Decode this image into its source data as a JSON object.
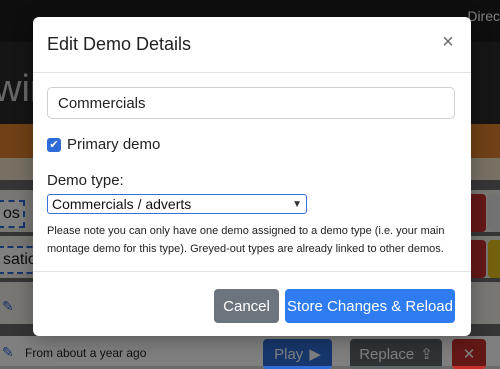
{
  "background": {
    "topbar_text": "Direc",
    "hero_text": "wir",
    "chip_1": "os",
    "chip_2": "satio",
    "bottom_row_text": "From about a year ago",
    "play_label": "Play",
    "replace_label": "Replace"
  },
  "modal": {
    "title": "Edit Demo Details",
    "close_glyph": "×",
    "name_value": "Commercials",
    "primary_checked": true,
    "primary_label": "Primary demo",
    "type_label": "Demo type:",
    "type_selected": "Commercials / adverts",
    "note": "Please note you can only have one demo assigned to a demo type (i.e. your main montage demo for this type). Greyed-out types are already linked to other demos.",
    "cancel_label": "Cancel",
    "store_label": "Store Changes & Reload"
  },
  "colors": {
    "primary": "#2f7cf0",
    "secondary": "#6c757d",
    "danger": "#c9302c"
  }
}
